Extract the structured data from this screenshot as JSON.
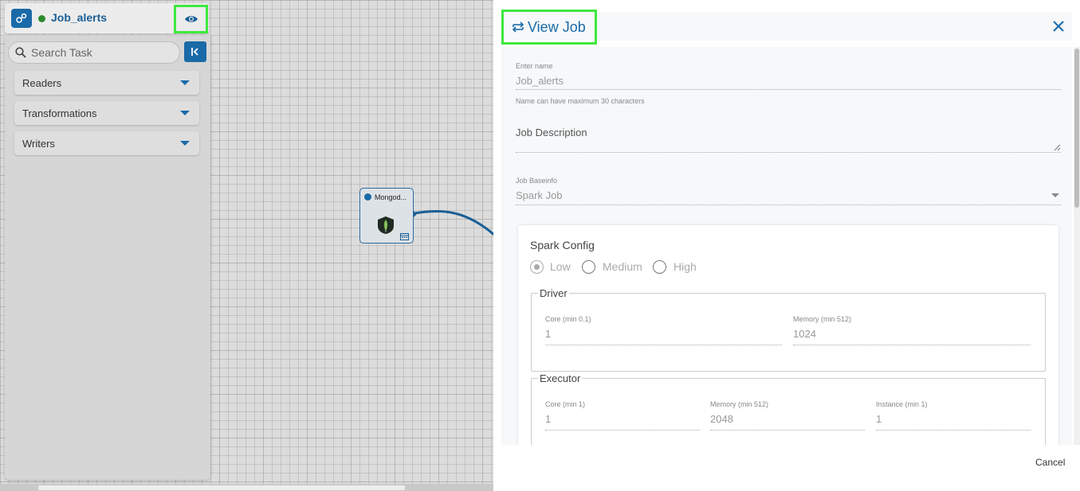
{
  "job": {
    "title": "Job_alerts",
    "status_color": "#2e8b2e"
  },
  "sidebar": {
    "search_placeholder": "Search Task",
    "categories": [
      {
        "label": "Readers"
      },
      {
        "label": "Transformations"
      },
      {
        "label": "Writers"
      }
    ]
  },
  "canvas": {
    "node": {
      "label": "Mongod...",
      "icon": "mongodb-leaf-icon"
    }
  },
  "panel": {
    "title": "View Job",
    "form": {
      "name_label": "Enter name",
      "name_value": "Job_alerts",
      "name_hint": "Name can have maximum 30 characters",
      "description_label": "Job Description",
      "baseinfo_label": "Job Baseinfo",
      "baseinfo_value": "Spark Job",
      "spark_config": {
        "title": "Spark Config",
        "options": [
          "Low",
          "Medium",
          "High"
        ],
        "selected": "Low",
        "driver": {
          "legend": "Driver",
          "core_label": "Core (min 0.1)",
          "core_value": "1",
          "memory_label": "Memory (min 512)",
          "memory_value": "1024"
        },
        "executor": {
          "legend": "Executor",
          "core_label": "Core (min 1)",
          "core_value": "1",
          "memory_label": "Memory (min 512)",
          "memory_value": "2048",
          "instance_label": "Instance (min 1)",
          "instance_value": "1"
        }
      }
    },
    "cancel_label": "Cancel"
  },
  "colors": {
    "accent": "#1a6aa8",
    "highlight": "#3ee83e"
  }
}
